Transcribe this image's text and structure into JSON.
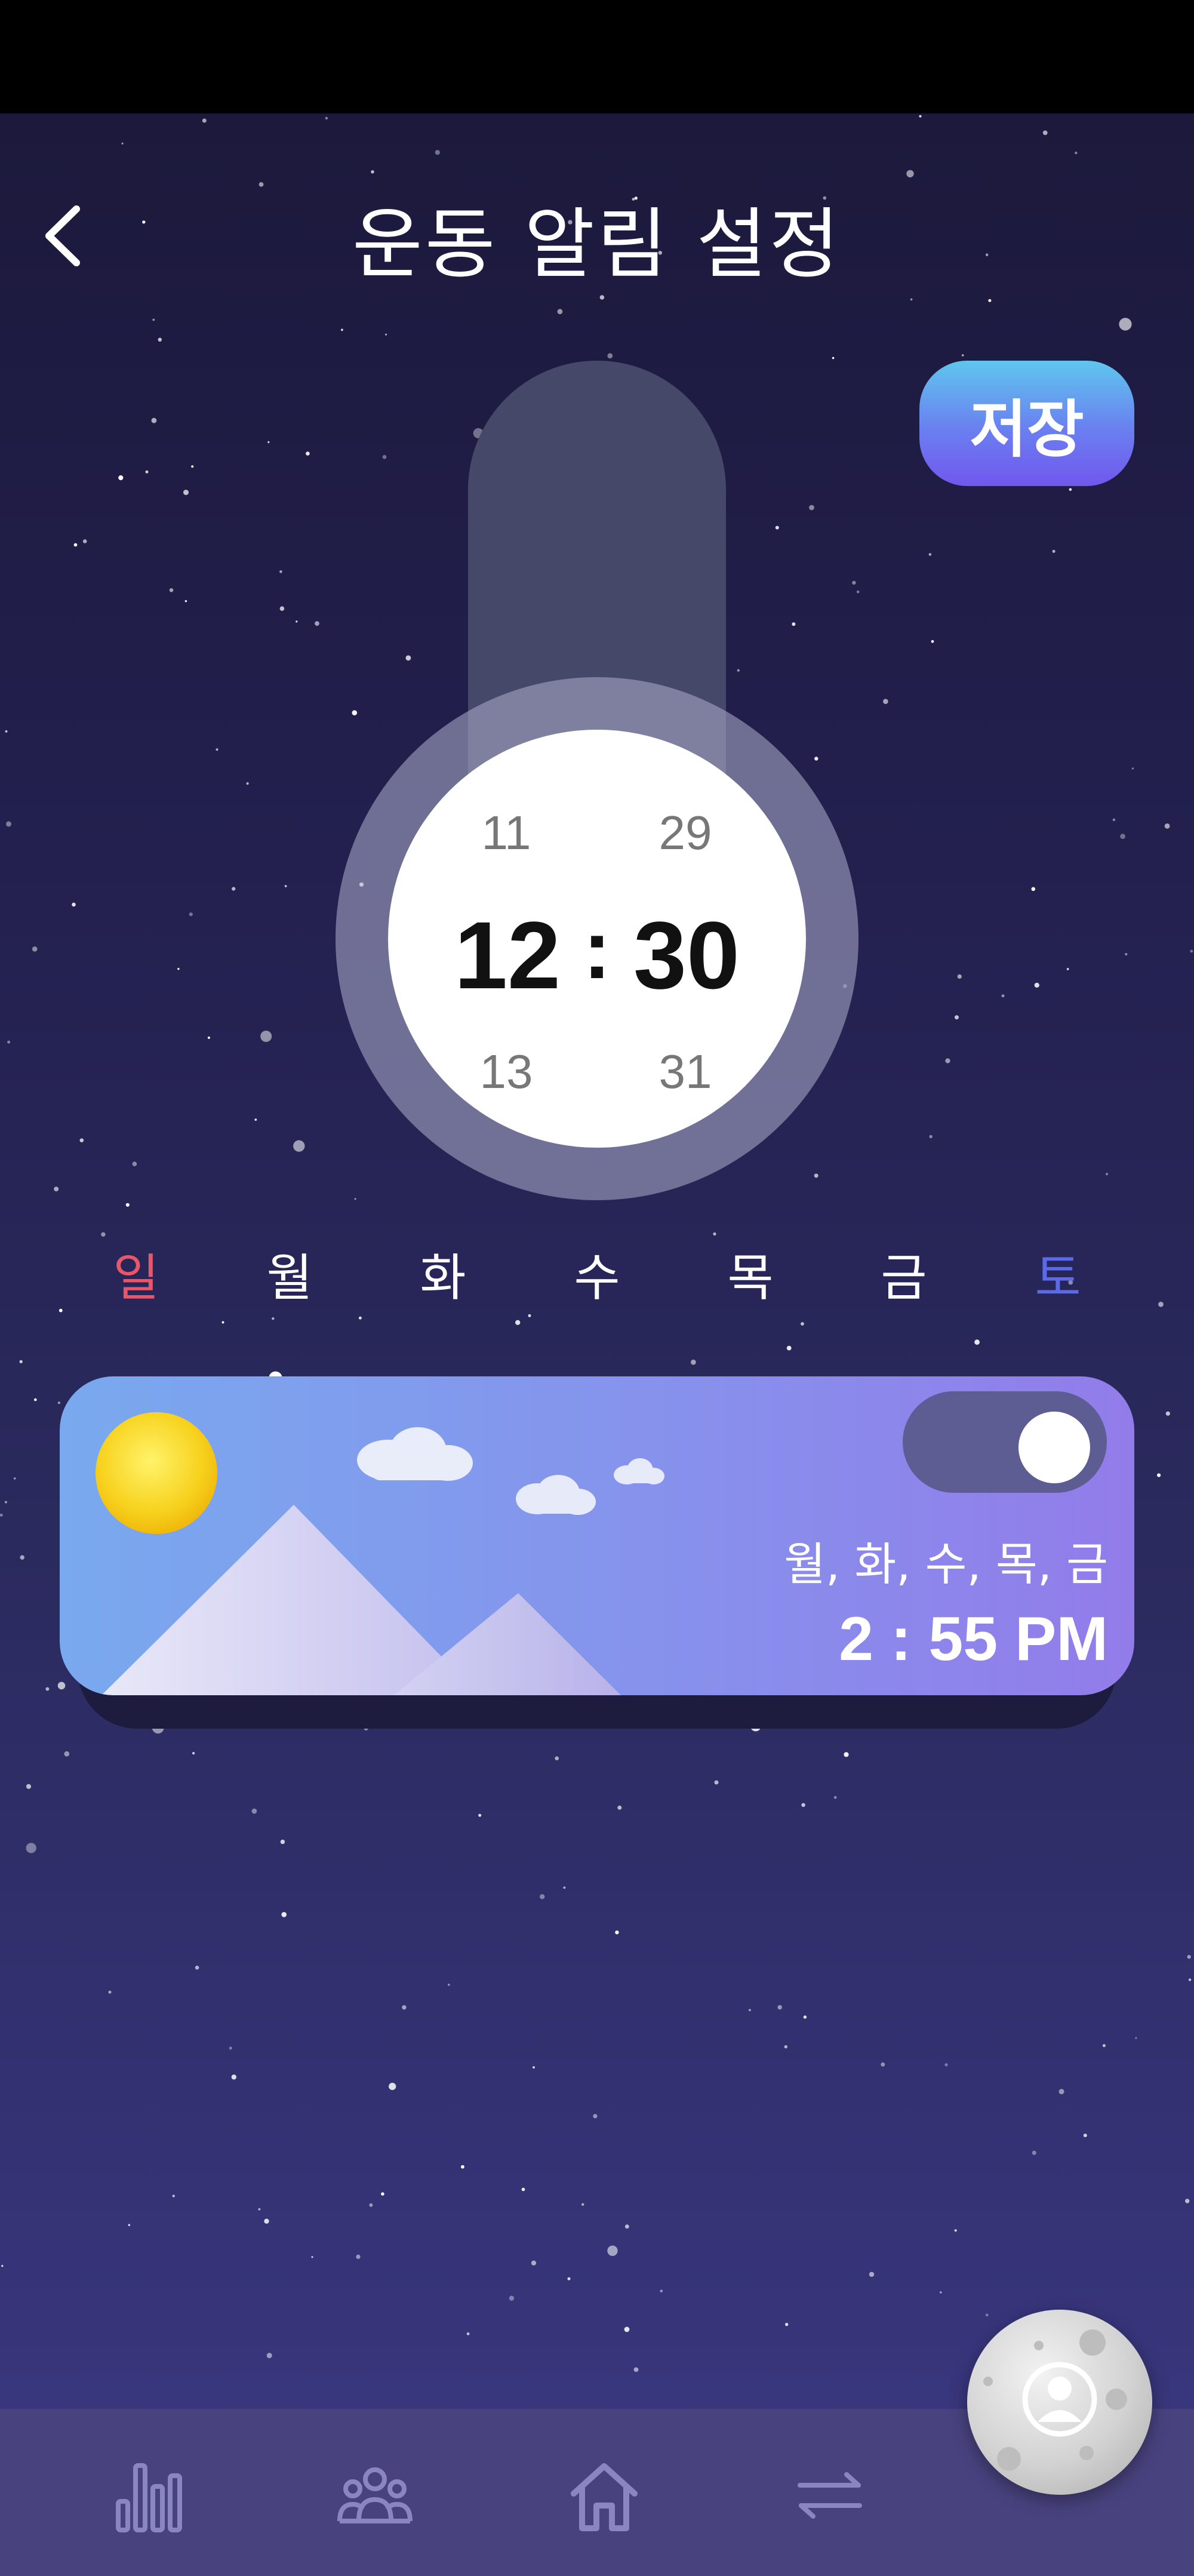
{
  "header": {
    "title": "운동 알림 설정",
    "save_label": "저장"
  },
  "time_picker": {
    "hour_prev": "11",
    "hour": "12",
    "hour_next": "13",
    "separator": ":",
    "minute_prev": "29",
    "minute": "30",
    "minute_next": "31"
  },
  "weekdays": [
    {
      "label": "일",
      "color": "#e8566a"
    },
    {
      "label": "월",
      "color": "#ffffff"
    },
    {
      "label": "화",
      "color": "#ffffff"
    },
    {
      "label": "수",
      "color": "#ffffff"
    },
    {
      "label": "목",
      "color": "#ffffff"
    },
    {
      "label": "금",
      "color": "#ffffff"
    },
    {
      "label": "토",
      "color": "#5b6be8"
    }
  ],
  "alarm_card": {
    "days": "월, 화, 수, 목, 금",
    "time": "2 : 55 PM",
    "enabled": true
  },
  "bottom_nav": [
    {
      "icon": "bar-chart-icon"
    },
    {
      "icon": "group-icon"
    },
    {
      "icon": "home-icon"
    },
    {
      "icon": "swap-arrows-icon"
    }
  ],
  "profile_button": {
    "icon": "moon-avatar-icon"
  },
  "colors": {
    "save_button_top": "#5fc6ee",
    "save_button_bottom": "#7257ee",
    "sunday": "#e8566a",
    "saturday": "#5b6be8",
    "card_gradient_left": "#79a9ee",
    "card_gradient_right": "#927cea"
  }
}
